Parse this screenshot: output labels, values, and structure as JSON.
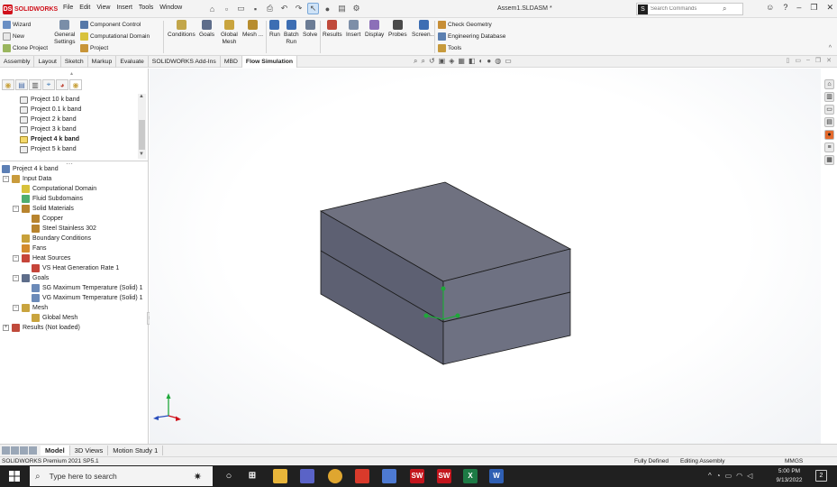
{
  "app": {
    "logo_text": "SOLIDWORKS",
    "document_title": "Assem1.SLDASM *",
    "menus": [
      "File",
      "Edit",
      "View",
      "Insert",
      "Tools",
      "Window"
    ]
  },
  "search": {
    "placeholder": "Search Commands"
  },
  "ribbon": {
    "wizard": "Wizard",
    "new": "New",
    "clone_project": "Clone Project",
    "general_settings_1": "General",
    "general_settings_2": "Settings",
    "component_control": "Component Control",
    "computational_domain": "Computational Domain",
    "project": "Project",
    "conditions": "Conditions",
    "goals": "Goals",
    "global_mesh_1": "Global",
    "global_mesh_2": "Mesh",
    "mesh": "Mesh ...",
    "run_1": "Run",
    "batch_run_1": "Batch",
    "batch_run_2": "Run",
    "solve": "Solve",
    "results": "Results",
    "insert": "Insert",
    "display": "Display",
    "probes": "Probes",
    "screen": "Screen...",
    "check_geometry": "Check Geometry",
    "engineering_database": "Engineering Database",
    "tools": "Tools"
  },
  "tabs": [
    "Assembly",
    "Layout",
    "Sketch",
    "Markup",
    "Evaluate",
    "SOLIDWORKS Add-Ins",
    "MBD",
    "Flow Simulation"
  ],
  "active_tab": "Flow Simulation",
  "projects": [
    {
      "label": "Project 10 k band",
      "bold": false
    },
    {
      "label": "Project 0.1 k band",
      "bold": false
    },
    {
      "label": "Project 2 k band",
      "bold": false
    },
    {
      "label": "Project 3 k band",
      "bold": false
    },
    {
      "label": "Project 4 k band",
      "bold": true
    },
    {
      "label": "Project 5 k band",
      "bold": false
    }
  ],
  "tree": {
    "root": "Project 4 k band",
    "input_data": "Input Data",
    "computational_domain": "Computational Domain",
    "fluid_subdomains": "Fluid Subdomains",
    "solid_materials": "Solid Materials",
    "copper": "Copper",
    "steel": "Steel Stainless 302",
    "boundary_conditions": "Boundary Conditions",
    "fans": "Fans",
    "heat_sources": "Heat Sources",
    "vs_heat": "VS Heat Generation Rate 1",
    "goals": "Goals",
    "sg_max": "SG Maximum Temperature (Solid) 1",
    "vg_max": "VG Maximum Temperature (Solid) 1",
    "mesh": "Mesh",
    "global_mesh": "Global Mesh",
    "results": "Results (Not loaded)"
  },
  "bottom_tabs": [
    "Model",
    "3D Views",
    "Motion Study 1"
  ],
  "status": {
    "version": "SOLIDWORKS Premium 2021 SP5.1",
    "fully_defined": "Fully Defined",
    "editing": "Editing Assembly",
    "units": "MMGS"
  },
  "taskbar": {
    "search_placeholder": "Type here to search",
    "time": "5:00 PM",
    "date": "9/13/2022"
  },
  "colors": {
    "brand_red": "#d0111b",
    "box_top": "#6f7180",
    "box_front": "#4f5163",
    "box_right": "#686b7b"
  }
}
